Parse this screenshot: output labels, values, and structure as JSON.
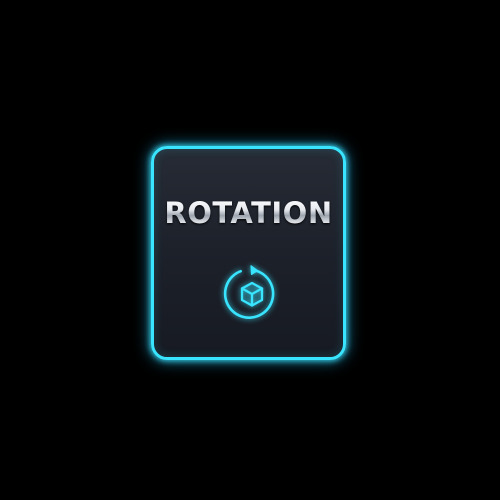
{
  "button": {
    "label": "ROTATION"
  },
  "icons": {
    "main": "rotate-cube-icon"
  },
  "colors": {
    "accent": "#39e4ff",
    "card_background": "#1c2029",
    "page_background": "#000000",
    "label_text": "#d9dde2"
  }
}
